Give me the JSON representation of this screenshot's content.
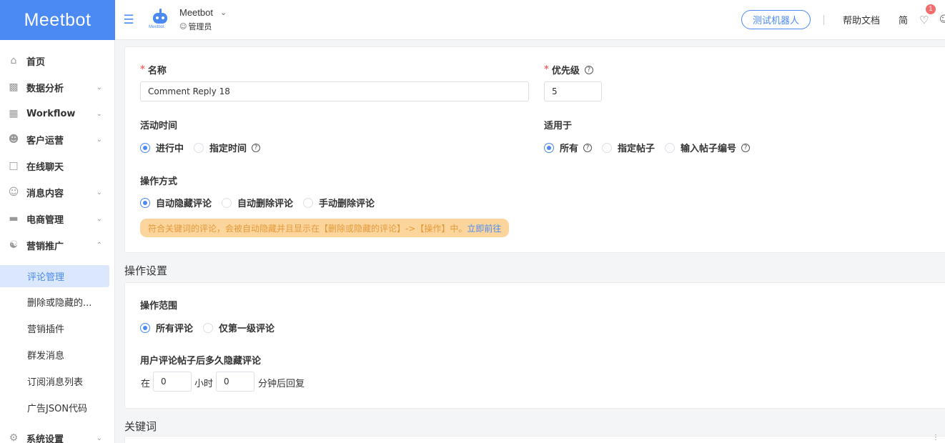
{
  "brand": {
    "logo_text": "Meetbot",
    "bot_text": "Meetbot",
    "accent": "#4b8af2"
  },
  "header": {
    "account_name": "Meetbot",
    "role": "管理员",
    "test_button": "测试机器人",
    "help": "帮助文档",
    "lang": "简",
    "notify_count": "1"
  },
  "sidebar": {
    "items": [
      {
        "label": "首页",
        "icon": "home-icon"
      },
      {
        "label": "数据分析",
        "icon": "chart-icon"
      },
      {
        "label": "Workflow",
        "icon": "workflow-icon"
      },
      {
        "label": "客户运营",
        "icon": "users-icon"
      },
      {
        "label": "在线聊天",
        "icon": "chat-icon"
      },
      {
        "label": "消息内容",
        "icon": "message-icon"
      },
      {
        "label": "电商管理",
        "icon": "shop-icon"
      },
      {
        "label": "营销推广",
        "icon": "marketing-icon"
      },
      {
        "label": "系统设置",
        "icon": "settings-icon"
      }
    ],
    "sub_items": [
      {
        "label": "评论管理"
      },
      {
        "label": "删除或隐藏的..."
      },
      {
        "label": "营销插件"
      },
      {
        "label": "群发消息"
      },
      {
        "label": "订阅消息列表"
      },
      {
        "label": "广告JSON代码"
      }
    ]
  },
  "form": {
    "name_label": "名称",
    "name_value": "Comment Reply 18",
    "priority_label": "优先级",
    "priority_value": "5",
    "active_time_label": "活动时间",
    "active_time_options": [
      "进行中",
      "指定时间"
    ],
    "apply_label": "适用于",
    "apply_options": [
      "所有",
      "指定帖子",
      "输入帖子编号"
    ],
    "mode_label": "操作方式",
    "mode_options": [
      "自动隐藏评论",
      "自动删除评论",
      "手动删除评论"
    ],
    "note_text": "符合关键词的评论，会被自动隐藏并且显示在【删除或隐藏的评论】->【操作】中。",
    "note_link": "立即前往"
  },
  "op_settings": {
    "title": "操作设置",
    "scope_label": "操作范围",
    "scope_options": [
      "所有评论",
      "仅第一级评论"
    ],
    "delay_label": "用户评论帖子后多久隐藏评论",
    "delay_prefix": "在",
    "hours_value": "0",
    "hours_unit": "小时",
    "minutes_value": "0",
    "minutes_suffix": "分钟后回复"
  },
  "keywords": {
    "title": "关键词"
  }
}
